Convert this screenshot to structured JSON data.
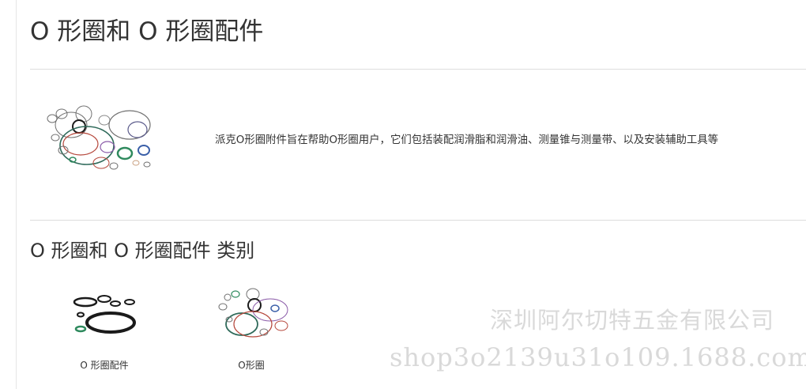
{
  "page": {
    "title": "O 形圈和 O 形圈配件"
  },
  "hero": {
    "image_icon": "o-rings-assortment-icon",
    "description": "派克O形圈附件旨在帮助O形圈用户，它们包括装配润滑脂和润滑油、测量锥与测量带、以及安装辅助工具等"
  },
  "categories_section": {
    "title": "O 形圈和 O 形圈配件 类别",
    "items": [
      {
        "label": "O 形圈配件",
        "icon": "o-ring-accessories-icon"
      },
      {
        "label": "O形圈",
        "icon": "o-rings-icon"
      }
    ]
  },
  "watermark": {
    "company": "深圳阿尔切特五金有限公司",
    "shop": "shop3o2139u31o109.1688.com"
  },
  "colors": {
    "ring_black": "#1a1a1a",
    "ring_green": "#2f8a5e",
    "ring_red": "#b5463a",
    "ring_blue": "#3a5fa8",
    "ring_purple": "#8a5aa8",
    "ring_gray": "#707070"
  }
}
